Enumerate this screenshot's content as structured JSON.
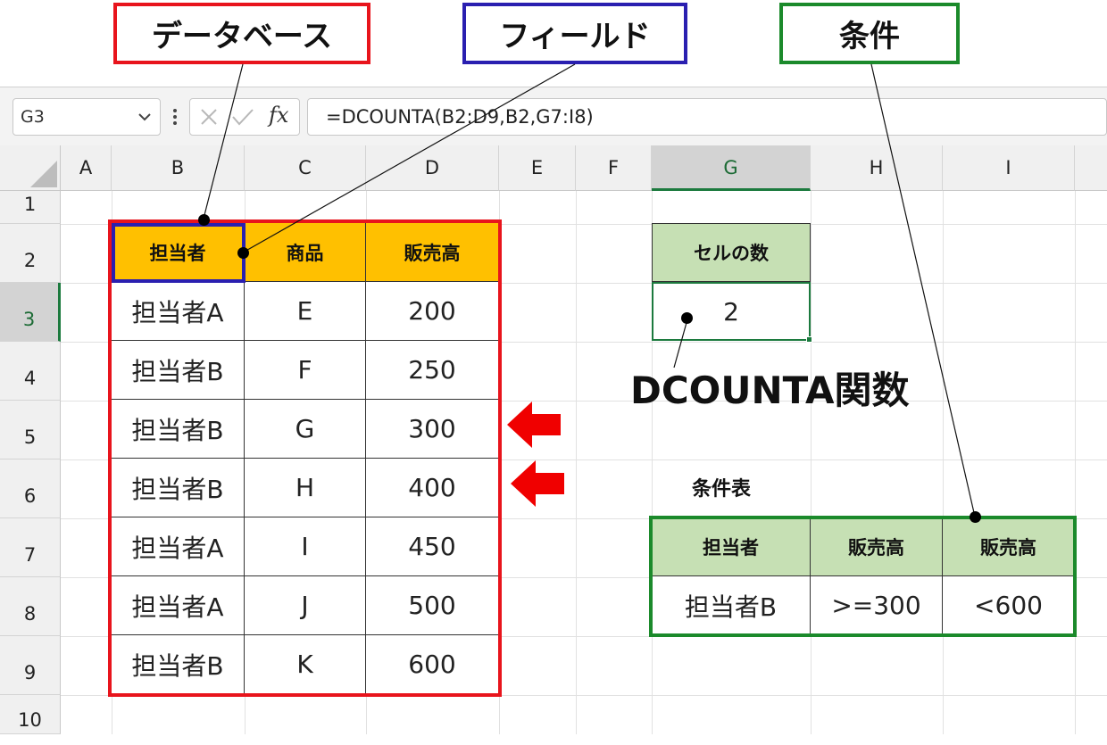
{
  "callouts": {
    "database": "データベース",
    "field": "フィールド",
    "criteria": "条件"
  },
  "colors": {
    "database_border": "#e8141c",
    "field_border": "#2a1fb0",
    "criteria_border": "#1b8a2b",
    "header_gold": "#ffc000",
    "header_green": "#c6e0b4",
    "arrow_red": "#f00000"
  },
  "excel": {
    "name_box": "G3",
    "formula": "=DCOUNTA(B2:D9,B2,G7:I8)",
    "fx_label": "fx",
    "columns": [
      "A",
      "B",
      "C",
      "D",
      "E",
      "F",
      "G",
      "H",
      "I"
    ],
    "rows": [
      "1",
      "2",
      "3",
      "4",
      "5",
      "6",
      "7",
      "8",
      "9",
      "10"
    ],
    "selected_column": "G",
    "selected_row": "3"
  },
  "database": {
    "headers": [
      "担当者",
      "商品",
      "販売高"
    ],
    "rows": [
      [
        "担当者A",
        "E",
        "200"
      ],
      [
        "担当者B",
        "F",
        "250"
      ],
      [
        "担当者B",
        "G",
        "300"
      ],
      [
        "担当者B",
        "H",
        "400"
      ],
      [
        "担当者A",
        "I",
        "450"
      ],
      [
        "担当者A",
        "J",
        "500"
      ],
      [
        "担当者B",
        "K",
        "600"
      ]
    ]
  },
  "result": {
    "header": "セルの数",
    "value": "2",
    "label": "DCOUNTA関数"
  },
  "criteria_table": {
    "title": "条件表",
    "headers": [
      "担当者",
      "販売高",
      "販売高"
    ],
    "values": [
      "担当者B",
      ">=300",
      "<600"
    ]
  },
  "icons": {
    "dropdown": "chevron-down-icon",
    "more": "vertical-dots-icon",
    "cancel": "x-icon",
    "enter": "check-icon",
    "function": "fx-icon",
    "select_all": "select-all-triangle-icon",
    "arrow": "arrow-left-icon"
  }
}
